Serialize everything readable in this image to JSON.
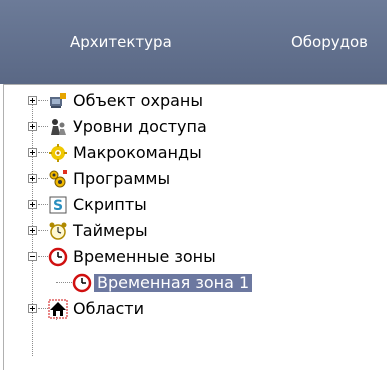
{
  "tabs": [
    {
      "label": "Архитектура"
    },
    {
      "label": "Оборудов"
    }
  ],
  "tree": {
    "items": [
      {
        "label": "Объект охраны",
        "icon": "object-icon",
        "expander": "plus"
      },
      {
        "label": "Уровни доступа",
        "icon": "access-levels-icon",
        "expander": "plus"
      },
      {
        "label": "Макрокоманды",
        "icon": "macro-icon",
        "expander": "plus"
      },
      {
        "label": "Программы",
        "icon": "programs-icon",
        "expander": "plus"
      },
      {
        "label": "Скрипты",
        "icon": "scripts-icon",
        "expander": "plus"
      },
      {
        "label": "Таймеры",
        "icon": "timer-icon",
        "expander": "plus"
      },
      {
        "label": "Временные зоны",
        "icon": "time-zone-icon",
        "expander": "minus"
      },
      {
        "label": "Временная зона 1",
        "icon": "time-zone-icon",
        "selected": true
      },
      {
        "label": "Области",
        "icon": "area-icon",
        "expander": "plus"
      }
    ]
  },
  "colors": {
    "tab_strip": "#5f6e8c",
    "selection": "#6c78a0"
  }
}
